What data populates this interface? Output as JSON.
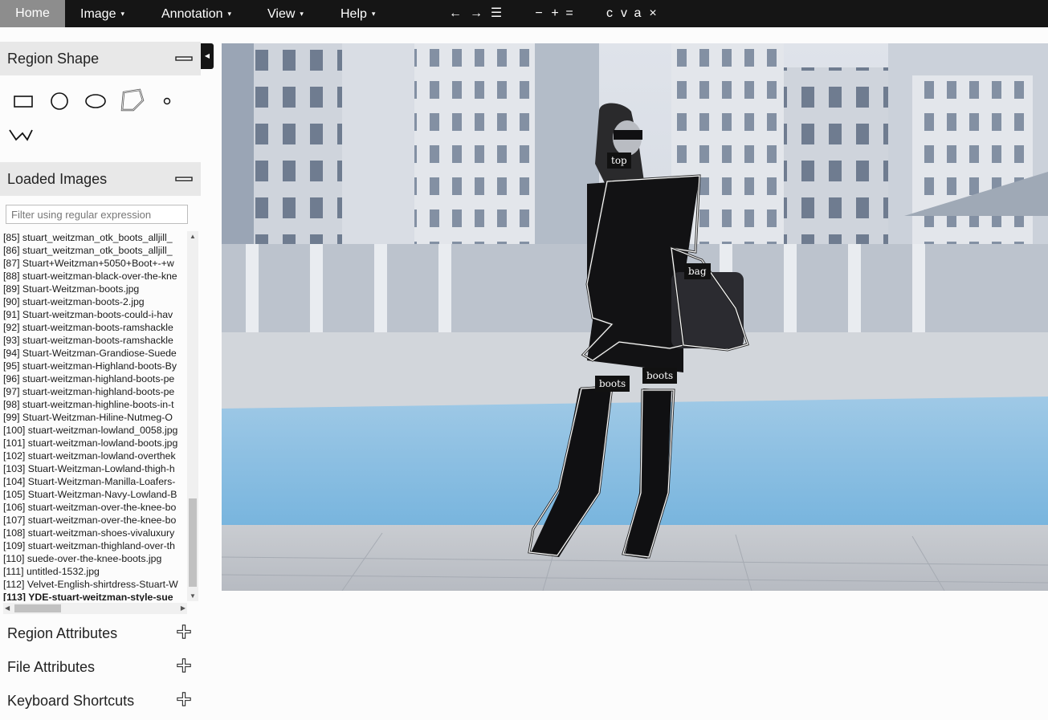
{
  "menu": {
    "home": "Home",
    "image": "Image",
    "annotation": "Annotation",
    "view": "View",
    "help": "Help",
    "caret": "▾"
  },
  "toolbar": {
    "prev": "←",
    "next": "→",
    "list": "☰",
    "zoom_out": "−",
    "zoom_in": "+",
    "zoom_reset": "=",
    "copy": "c",
    "paste": "v",
    "select_all": "a",
    "delete": "×"
  },
  "panels": {
    "region_shape": "Region Shape",
    "loaded_images": "Loaded Images",
    "region_attributes": "Region Attributes",
    "file_attributes": "File Attributes",
    "keyboard_shortcuts": "Keyboard Shortcuts"
  },
  "shapes": [
    "rectangle",
    "circle",
    "ellipse",
    "polygon",
    "point",
    "polyline"
  ],
  "filter": {
    "placeholder": "Filter using regular expression",
    "value": ""
  },
  "images": [
    "[85] stuart_weitzman_otk_boots_alljill_",
    "[86] stuart_weitzman_otk_boots_alljill_",
    "[87] Stuart+Weitzman+5050+Boot+-+w",
    "[88] stuart-weitzman-black-over-the-kne",
    "[89] Stuart-Weitzman-boots.jpg",
    "[90] stuart-weitzman-boots-2.jpg",
    "[91] Stuart-weitzman-boots-could-i-hav",
    "[92] stuart-weitzman-boots-ramshackle",
    "[93] stuart-weitzman-boots-ramshackle",
    "[94] Stuart-Weitzman-Grandiose-Suede",
    "[95] stuart-weitzman-Highland-boots-By",
    "[96] stuart-weitzman-highland-boots-pe",
    "[97] stuart-weitzman-highland-boots-pe",
    "[98] stuart-weitzman-highline-boots-in-t",
    "[99] Stuart-Weitzman-Hiline-Nutmeg-O",
    "[100] stuart-weitzman-lowland_0058.jpg",
    "[101] stuart-weitzman-lowland-boots.jpg",
    "[102] stuart-weitzman-lowland-overthek",
    "[103] Stuart-Weitzman-Lowland-thigh-h",
    "[104] Stuart-Weitzman-Manilla-Loafers-",
    "[105] Stuart-Weitzman-Navy-Lowland-B",
    "[106] stuart-weitzman-over-the-knee-bo",
    "[107] stuart-weitzman-over-the-knee-bo",
    "[108] stuart-weitzman-shoes-vivaluxury",
    "[109] stuart-weitzman-thighland-over-th",
    "[110] suede-over-the-knee-boots.jpg",
    "[111] untitled-1532.jpg",
    "[112] Velvet-English-shirtdress-Stuart-W",
    "[113] YDE-stuart-weitzman-style-sue"
  ],
  "active_image_index": 28,
  "regions": [
    {
      "label": "top"
    },
    {
      "label": "bag"
    },
    {
      "label": "boots"
    },
    {
      "label": "boots"
    }
  ],
  "colors": {
    "menubar": "#151515",
    "home_active": "#8d8d8d",
    "panel_header": "#e8e8e8",
    "label_bg": "#111111"
  }
}
